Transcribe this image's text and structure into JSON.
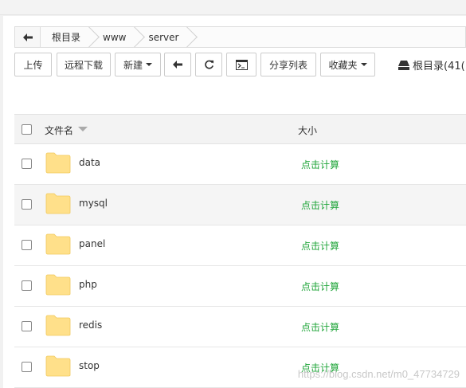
{
  "breadcrumb": {
    "items": [
      "根目录",
      "www",
      "server"
    ]
  },
  "toolbar": {
    "upload": "上传",
    "remote_download": "远程下载",
    "new": "新建",
    "share_list": "分享列表",
    "favorites": "收藏夹",
    "root_dir": "根目录(41("
  },
  "table": {
    "col_name": "文件名",
    "col_size": "大小",
    "rows": [
      {
        "name": "data",
        "size": "点击计算"
      },
      {
        "name": "mysql",
        "size": "点击计算"
      },
      {
        "name": "panel",
        "size": "点击计算"
      },
      {
        "name": "php",
        "size": "点击计算"
      },
      {
        "name": "redis",
        "size": "点击计算"
      },
      {
        "name": "stop",
        "size": "点击计算"
      }
    ]
  },
  "watermark": "https://blog.csdn.net/m0_47734729",
  "colors": {
    "accent_green": "#20a53a",
    "folder_yellow": "#ffe08a"
  }
}
